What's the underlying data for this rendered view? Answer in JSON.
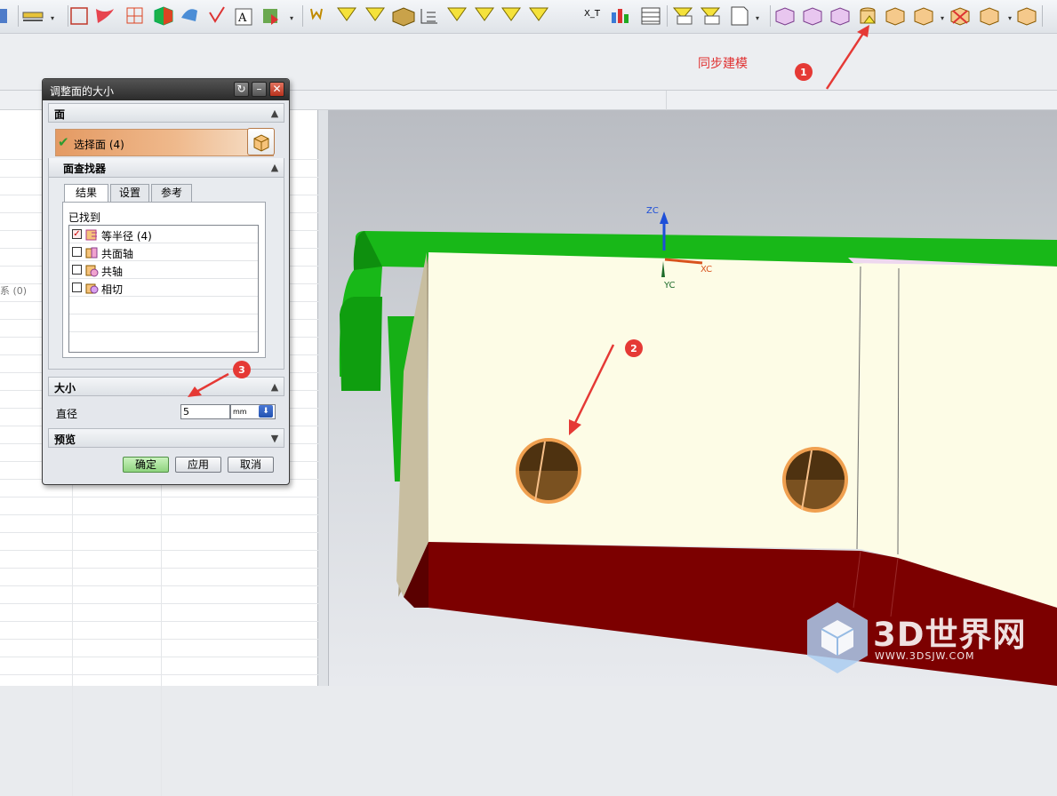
{
  "toolbar": {
    "icons": [
      "sketch-icon",
      "measure-icon",
      "view-icon",
      "curve-icon",
      "point-icon",
      "cube-icon",
      "paint-icon",
      "check-icon",
      "text-icon",
      "render-icon",
      "attribute-icon",
      "feature-icon",
      "sketch-constraint-icon",
      "solid-icon",
      "tree-icon",
      "relate-icon",
      "checkmark-filter-icon",
      "text-filter-icon",
      "delete-filter-icon",
      "xt-icon",
      "chart-icon",
      "table-icon",
      "face-icon",
      "mirror-icon",
      "page-icon",
      "move-face-icon",
      "pull-face-icon",
      "offset-face-icon",
      "resize-face-icon",
      "replace-face-icon",
      "delete-face-icon",
      "pattern-face-icon",
      "copy-face-icon",
      "group-face-icon"
    ]
  },
  "annotations": {
    "sync_modeling": "同步建模",
    "marker1": "1",
    "marker2": "2",
    "marker3": "3"
  },
  "navigator": {
    "partial_text": "系 (0)"
  },
  "viewport": {
    "axes": {
      "zc": "ZC",
      "xc": "XC",
      "yc": "YC"
    }
  },
  "dialog": {
    "title": "调整面的大小",
    "face_section": "面",
    "select_face": "选择面 (4)",
    "finder_section": "面查找器",
    "tabs": [
      "结果",
      "设置",
      "参考"
    ],
    "found_label": "已找到",
    "found_items": [
      {
        "label": "等半径 (4)",
        "checked": true
      },
      {
        "label": "共面轴",
        "checked": false
      },
      {
        "label": "共轴",
        "checked": false
      },
      {
        "label": "相切",
        "checked": false
      }
    ],
    "size_section": "大小",
    "diameter_label": "直径",
    "diameter_value": "5",
    "unit": "mm",
    "preview_section": "预览",
    "buttons": {
      "ok": "确定",
      "apply": "应用",
      "cancel": "取消"
    }
  },
  "watermark": {
    "brand": "3D世界网",
    "url": "WWW.3DSJW.COM"
  },
  "colors": {
    "accent": "#e03131",
    "model_green": "#1fc21f",
    "model_face": "#fdfce6",
    "model_red": "#7c0000",
    "hole_orange": "#f0a050"
  }
}
